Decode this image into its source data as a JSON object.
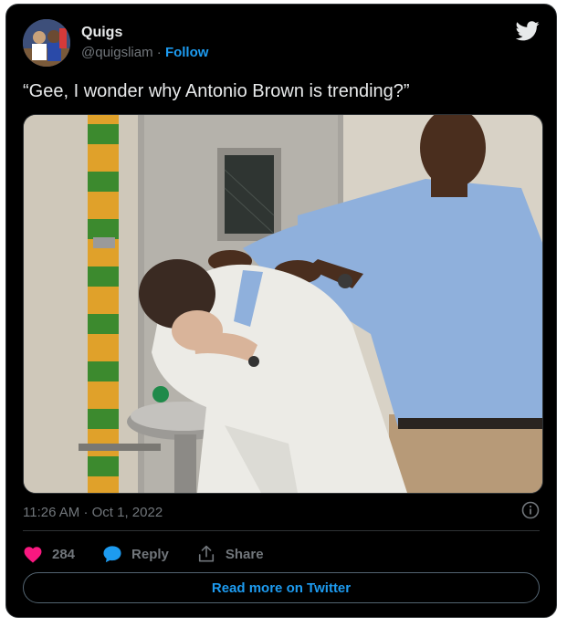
{
  "author": {
    "name": "Quigs",
    "handle": "@quigsliam",
    "separator": "·",
    "follow_label": "Follow"
  },
  "tweet": {
    "text": "“Gee, I wonder why Antonio Brown is trending?”",
    "time": "11:26 AM",
    "date": "Oct 1, 2022",
    "separator": "·"
  },
  "actions": {
    "likes": "284",
    "reply_label": "Reply",
    "share_label": "Share"
  },
  "read_more_label": "Read more on Twitter",
  "colors": {
    "background": "#000000",
    "accent": "#1d9bf0",
    "like": "#f91880",
    "muted": "#71767b",
    "text": "#e7e9ea"
  },
  "icons": [
    "twitter-bird-icon",
    "info-icon",
    "heart-icon",
    "reply-bubble-icon",
    "share-icon"
  ]
}
